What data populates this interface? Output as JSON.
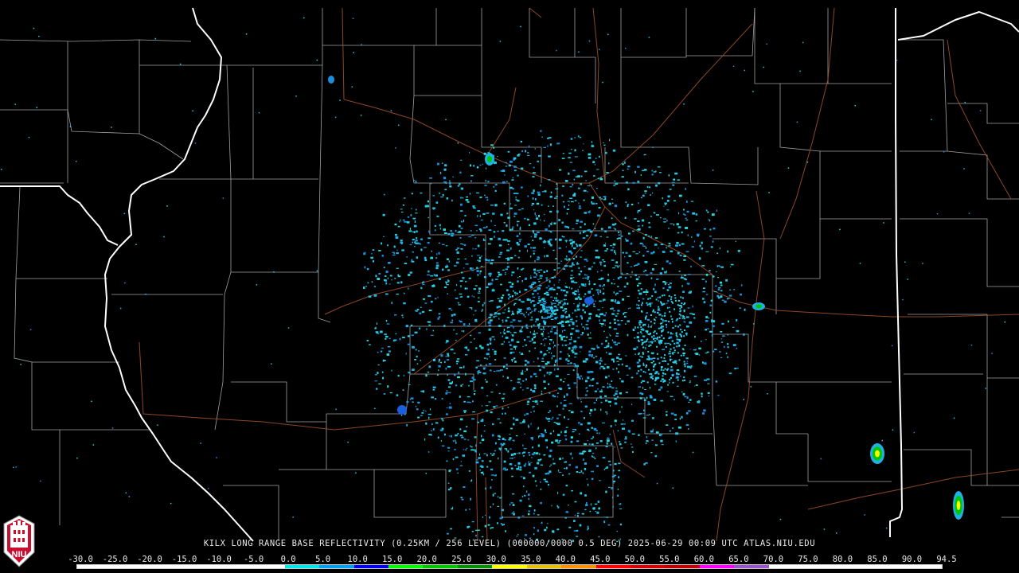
{
  "caption": "KILX LONG RANGE BASE REFLECTIVITY (0.25KM / 256 LEVEL) (000000/0000 0.5 DEG) 2025-06-29 00:09 UTC  ATLAS.NIU.EDU",
  "logo": {
    "text": "NIU",
    "icon": "niu-logo-icon",
    "colors": {
      "bg": "#c8102e",
      "fg": "#ffffff"
    }
  },
  "scale": {
    "labels": [
      "-30.0",
      "-25.0",
      "-20.0",
      "-15.0",
      "-10.0",
      "-5.0",
      "0.0",
      "5.0",
      "10.0",
      "15.0",
      "20.0",
      "25.0",
      "30.0",
      "35.0",
      "40.0",
      "45.0",
      "50.0",
      "55.0",
      "60.0",
      "65.0",
      "70.0",
      "75.0",
      "80.0",
      "85.0",
      "90.0",
      "94.5"
    ],
    "colors": [
      "#ffffff",
      "#ffffff",
      "#ffffff",
      "#ffffff",
      "#ffffff",
      "#ffffff",
      "#00e8e8",
      "#00a0f0",
      "#0000f0",
      "#00ff00",
      "#00c800",
      "#009000",
      "#ffff00",
      "#e7c000",
      "#ff9000",
      "#ff0000",
      "#d60000",
      "#c00000",
      "#ff00ff",
      "#9955c9",
      "#ffffff",
      "#ffffff",
      "#ffffff",
      "#ffffff",
      "#ffffff"
    ]
  },
  "map_colors": {
    "background": "#000000",
    "county": "#c0c0c0",
    "state": "#ffffff",
    "highway": "#a0522d",
    "echo_main": "#22c5e0"
  }
}
